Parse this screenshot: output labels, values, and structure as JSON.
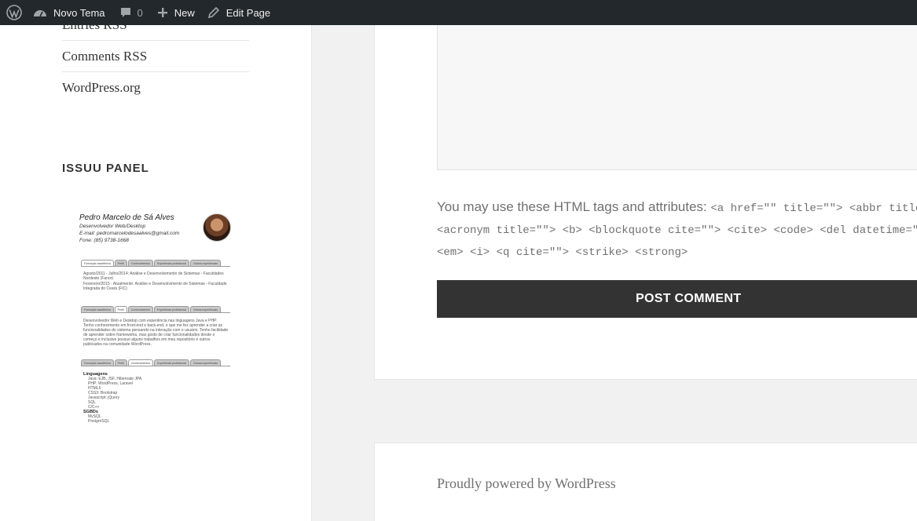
{
  "adminbar": {
    "site_name": "Novo Tema",
    "comments_count": "0",
    "new_label": "New",
    "edit_label": "Edit Page"
  },
  "sidebar": {
    "meta_links": [
      "Entries RSS",
      "Comments RSS",
      "WordPress.org"
    ],
    "issuu_title": "ISSUU PANEL",
    "cv": {
      "name": "Pedro Marcelo de Sá Alves",
      "role": "Desenvolvedor Web/Desktop",
      "email": "E-mail: pedromarcelodesaalves@gmail.com",
      "phone": "Fone: (85) 9738-1668",
      "tabs": [
        "Formação acadêmica",
        "Perfil",
        "Conhecimentos",
        "Experiência profissional",
        "Outras experiências"
      ],
      "education": [
        "Agosto/2011 - Julho/2014: Análise e Desenvolvimento de Sistemas - Faculdades Nordeste (Fanor)",
        "Fevereiro/2015 - Atualmente: Análise e Desenvolvimento de Sistemas - Faculdade Integrada do Ceará (FIC)"
      ],
      "profile": "Desenvolvedor Web e Desktop com experiência nas linguagens Java e PHP. Tenho conhecimento em front-end e back-end, o que me fez aprender a criar as funcionalidades do sistema pensando na interação com o usuário. Tenho facilidade de aprender sobre frameworks, mas gosto de criar funcionalidades desde o começo e inclusive possuo alguns trabalhos em meu repositório e outros publicados na comunidade WordPress.",
      "languages_title": "Linguagens",
      "languages": [
        "Java: EJB, JSF, Hibernate JPA",
        "PHP: WordPress, Laravel",
        "HTML5",
        "CSS3: Bootstrap",
        "Javascript: jQuery",
        "SQL",
        "C/C++"
      ],
      "db_title": "SGBDs",
      "dbs": [
        "MySQL",
        "PostgreSQL"
      ]
    }
  },
  "comment_form": {
    "allowed_intro": "You may use these HTML tags and attributes:",
    "allowed_line1": "<a href=\"\" title=\"\"> <abbr title=\"\">",
    "allowed_line2": "<acronym title=\"\"> <b> <blockquote cite=\"\"> <cite> <code> <del datetime=\"\">",
    "allowed_line3": "<em> <i> <q cite=\"\"> <strike> <strong>",
    "submit_label": "POST COMMENT"
  },
  "footer": {
    "powered": "Proudly powered by WordPress"
  }
}
